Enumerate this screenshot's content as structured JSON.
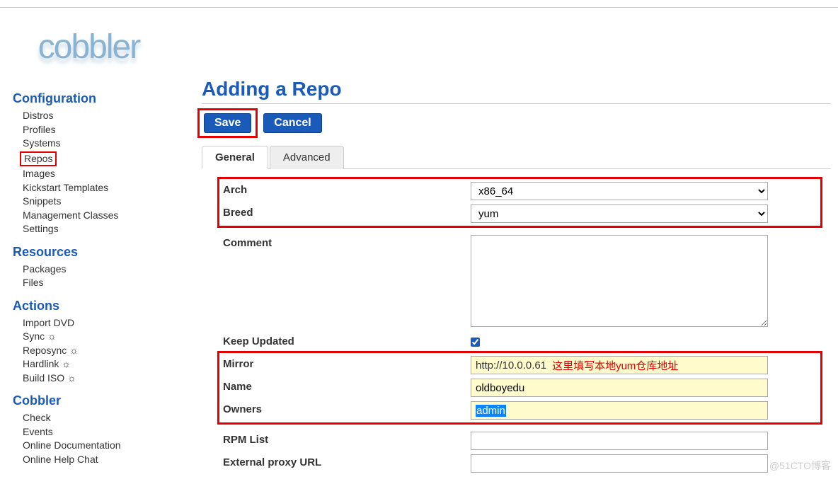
{
  "logo": "cobbler",
  "nav": {
    "configuration": {
      "title": "Configuration",
      "items": [
        "Distros",
        "Profiles",
        "Systems",
        "Repos",
        "Images",
        "Kickstart Templates",
        "Snippets",
        "Management Classes",
        "Settings"
      ]
    },
    "resources": {
      "title": "Resources",
      "items": [
        "Packages",
        "Files"
      ]
    },
    "actions": {
      "title": "Actions",
      "items": [
        "Import DVD",
        "Sync ☼",
        "Reposync ☼",
        "Hardlink ☼",
        "Build ISO ☼"
      ]
    },
    "cobbler": {
      "title": "Cobbler",
      "items": [
        "Check",
        "Events",
        "Online Documentation",
        "Online Help Chat"
      ]
    }
  },
  "page": {
    "title": "Adding a Repo",
    "save": "Save",
    "cancel": "Cancel"
  },
  "tabs": {
    "general": "General",
    "advanced": "Advanced"
  },
  "form": {
    "arch": {
      "label": "Arch",
      "value": "x86_64"
    },
    "breed": {
      "label": "Breed",
      "value": "yum"
    },
    "comment": {
      "label": "Comment",
      "value": ""
    },
    "keep_updated": {
      "label": "Keep Updated",
      "checked": true
    },
    "mirror": {
      "label": "Mirror",
      "value": "http://10.0.0.61",
      "annotation": "这里填写本地yum仓库地址"
    },
    "name": {
      "label": "Name",
      "value": "oldboyedu"
    },
    "owners": {
      "label": "Owners",
      "value": "admin"
    },
    "rpm_list": {
      "label": "RPM List",
      "value": ""
    },
    "external_proxy": {
      "label": "External proxy URL",
      "value": ""
    }
  },
  "watermark": "@51CTO博客"
}
